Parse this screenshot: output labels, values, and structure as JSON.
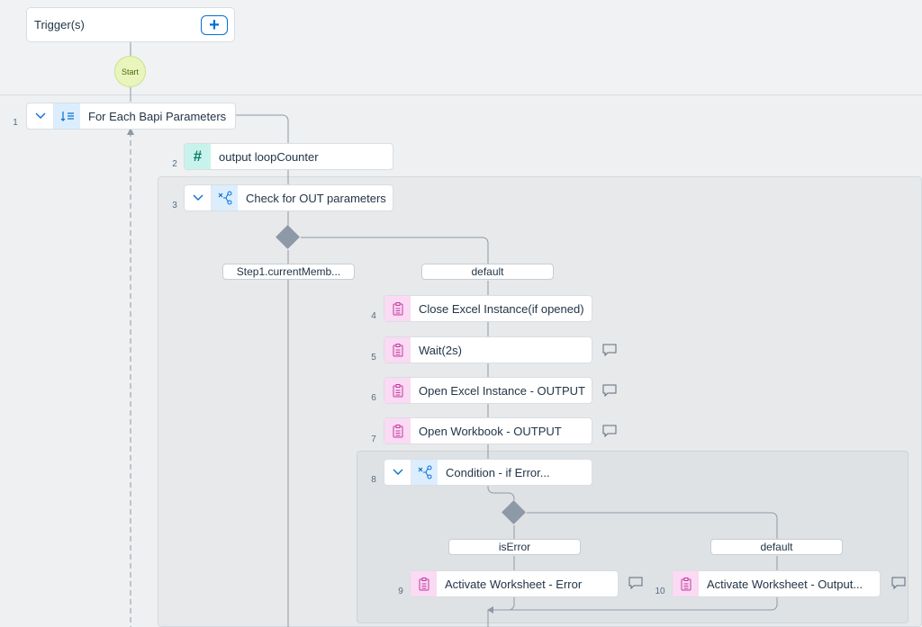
{
  "trigger": {
    "label": "Trigger(s)"
  },
  "start": {
    "label": "Start"
  },
  "steps": {
    "s1": {
      "no": "1",
      "label": "For Each Bapi Parameters"
    },
    "s2": {
      "no": "2",
      "label": "output loopCounter"
    },
    "s3": {
      "no": "3",
      "label": "Check for OUT parameters"
    },
    "s4": {
      "no": "4",
      "label": "Close Excel Instance(if opened)"
    },
    "s5": {
      "no": "5",
      "label": "Wait(2s)"
    },
    "s6": {
      "no": "6",
      "label": "Open Excel Instance - OUTPUT"
    },
    "s7": {
      "no": "7",
      "label": "Open Workbook - OUTPUT"
    },
    "s8": {
      "no": "8",
      "label": "Condition - if Error..."
    },
    "s9": {
      "no": "9",
      "label": "Activate Worksheet - Error"
    },
    "s10": {
      "no": "10",
      "label": "Activate Worksheet - Output..."
    }
  },
  "branches": {
    "b1": "Step1.currentMemb...",
    "b2": "default",
    "b3": "isError",
    "b4": "default"
  },
  "colors": {
    "accent": "#0a6ed1",
    "pink_icon": "#c0399f",
    "teal_icon": "#0f7e6c"
  }
}
